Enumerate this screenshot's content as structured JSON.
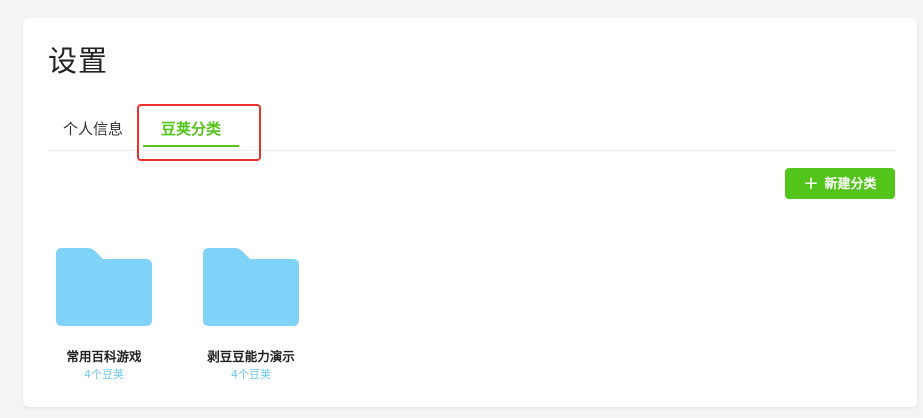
{
  "page": {
    "title": "设置"
  },
  "tabs": [
    {
      "label": "个人信息",
      "active": false
    },
    {
      "label": "豆荚分类",
      "active": true
    }
  ],
  "toolbar": {
    "new_category_label": "新建分类",
    "plus_icon": "plus-icon"
  },
  "folders": [
    {
      "name": "常用百科游戏",
      "count": "4个豆荚"
    },
    {
      "name": "剥豆豆能力演示",
      "count": "4个豆荚"
    }
  ],
  "colors": {
    "accent": "#52c41a",
    "folder": "#7fd3f8",
    "count_text": "#6cc9f5",
    "highlight": "#e8312a"
  }
}
